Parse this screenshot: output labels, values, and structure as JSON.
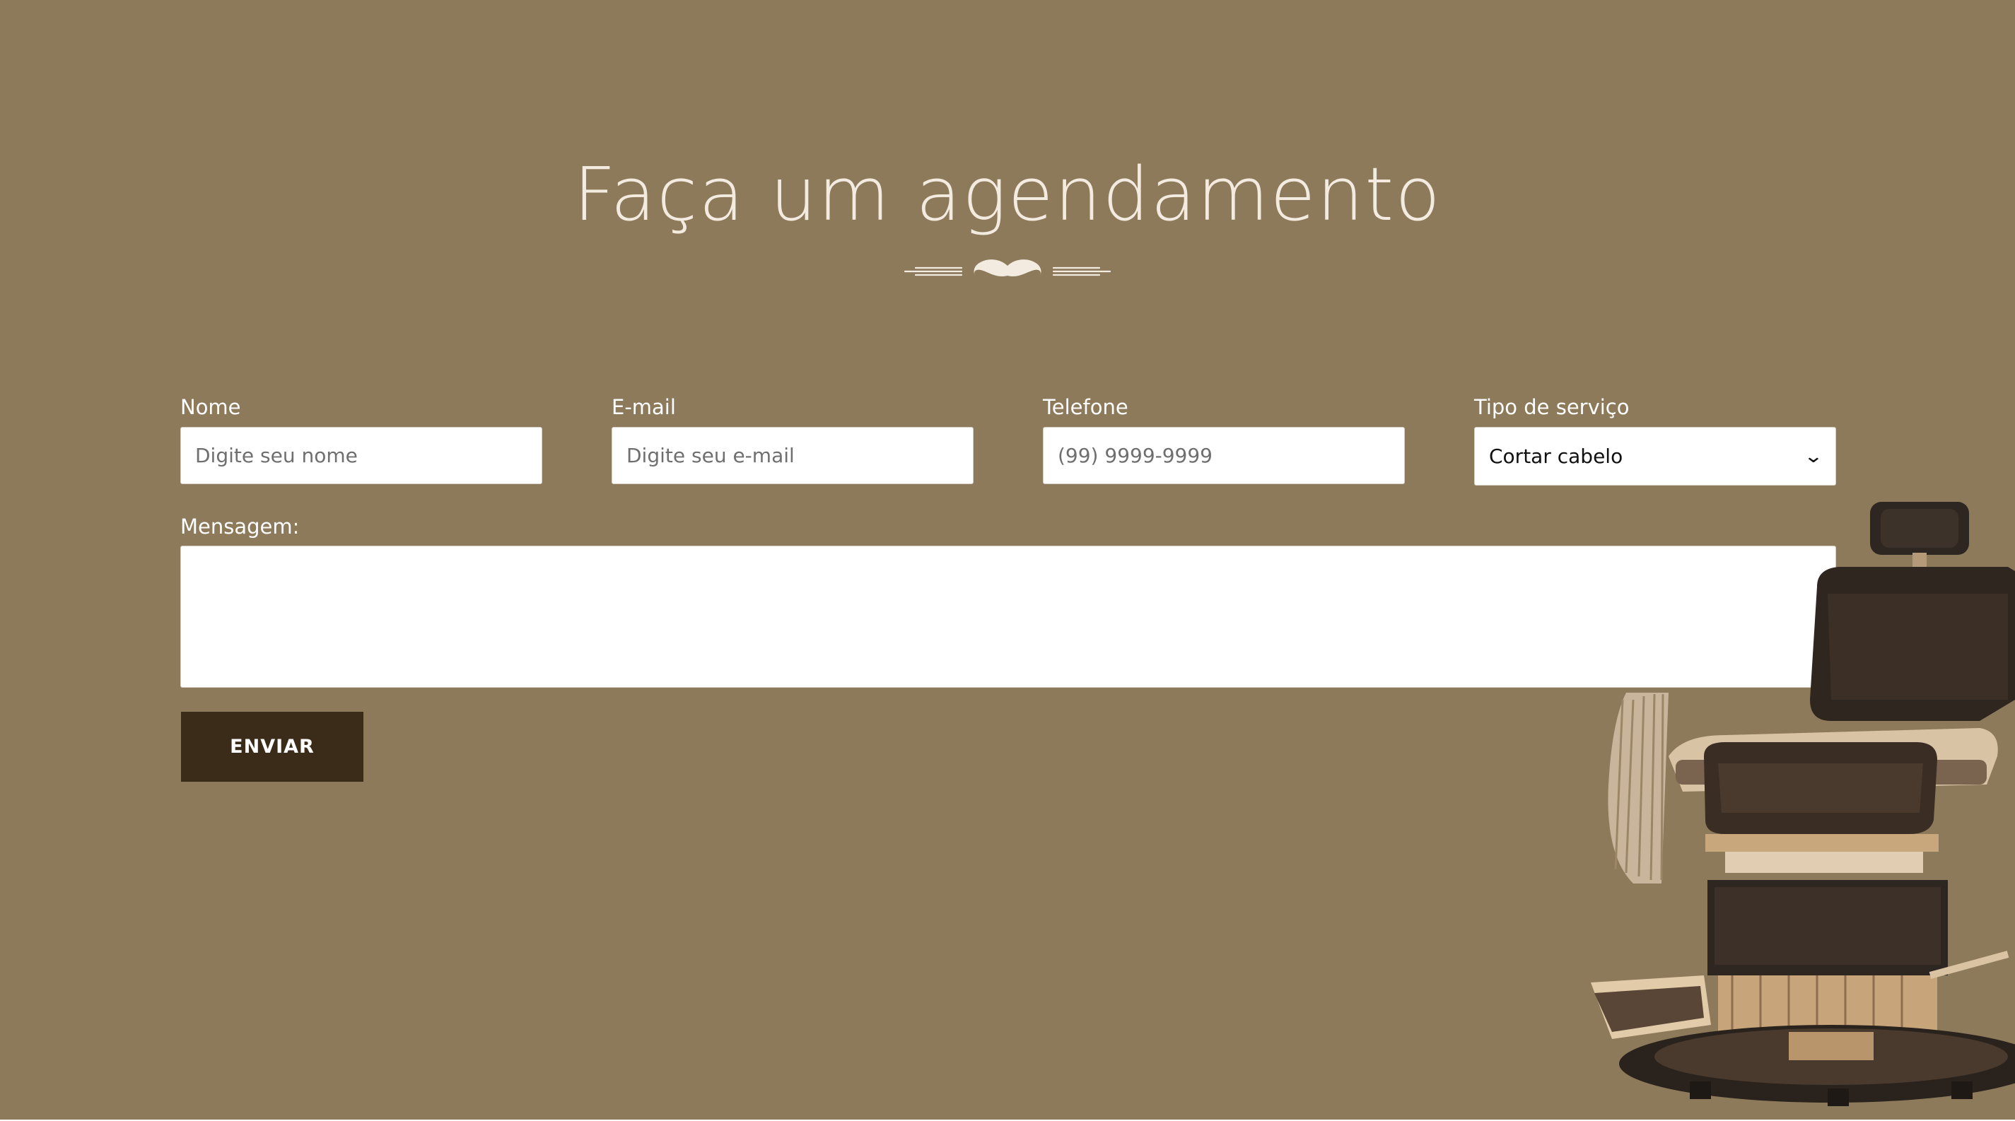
{
  "page": {
    "title": "Faça um agendamento",
    "background_color": "#8d7a5b",
    "accent_color": "#3b2c1a",
    "title_color": "#f3ebe0"
  },
  "divider": {
    "icon": "mustache-icon"
  },
  "form": {
    "name": {
      "label": "Nome",
      "placeholder": "Digite seu nome",
      "value": ""
    },
    "email": {
      "label": "E-mail",
      "placeholder": "Digite seu e-mail",
      "value": ""
    },
    "phone": {
      "label": "Telefone",
      "placeholder": "(99) 9999-9999",
      "value": ""
    },
    "service": {
      "label": "Tipo de serviço",
      "selected": "Cortar cabelo"
    },
    "message": {
      "label": "Mensagem:",
      "value": ""
    },
    "submit_label": "ENVIAR"
  },
  "decor": {
    "image": "barber-chair-image"
  }
}
